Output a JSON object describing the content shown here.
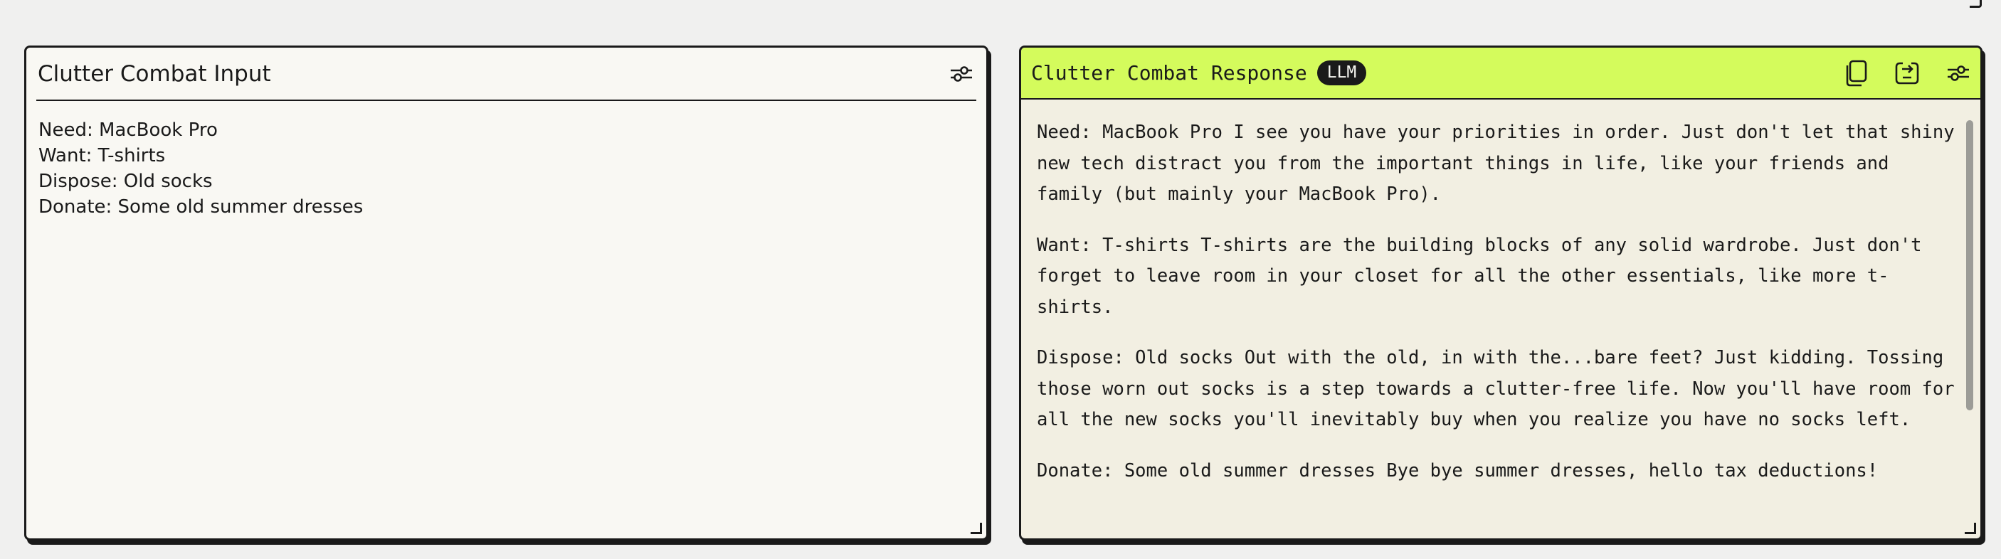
{
  "input_panel": {
    "title": "Clutter Combat Input",
    "settings_icon": "sliders-icon",
    "body_text": "Need: MacBook Pro\nWant: T-shirts\nDispose: Old socks\nDonate: Some old summer dresses"
  },
  "response_panel": {
    "title": "Clutter Combat Response",
    "badge": "LLM",
    "icons": [
      "copy-icon",
      "export-icon",
      "sliders-icon"
    ],
    "paragraphs": [
      "Need: MacBook Pro I see you have your priorities in order. Just don't let that shiny new tech distract you from the important things in life, like your friends and family (but mainly your MacBook Pro).",
      "Want: T-shirts T-shirts are the building blocks of any solid wardrobe. Just don't forget to leave room in your closet for all the other essentials, like more t-shirts.",
      "Dispose: Old socks Out with the old, in with the...bare feet? Just kidding. Tossing those worn out socks is a step towards a clutter-free life. Now you'll have room for all the new socks you'll inevitably buy when you realize you have no socks left.",
      "Donate: Some old summer dresses Bye bye summer dresses, hello tax deductions!"
    ]
  },
  "colors": {
    "accent": "#d4fb5c",
    "ink": "#1a1a1a",
    "input_bg": "#f9f8f3",
    "response_bg": "#f2efe2"
  }
}
